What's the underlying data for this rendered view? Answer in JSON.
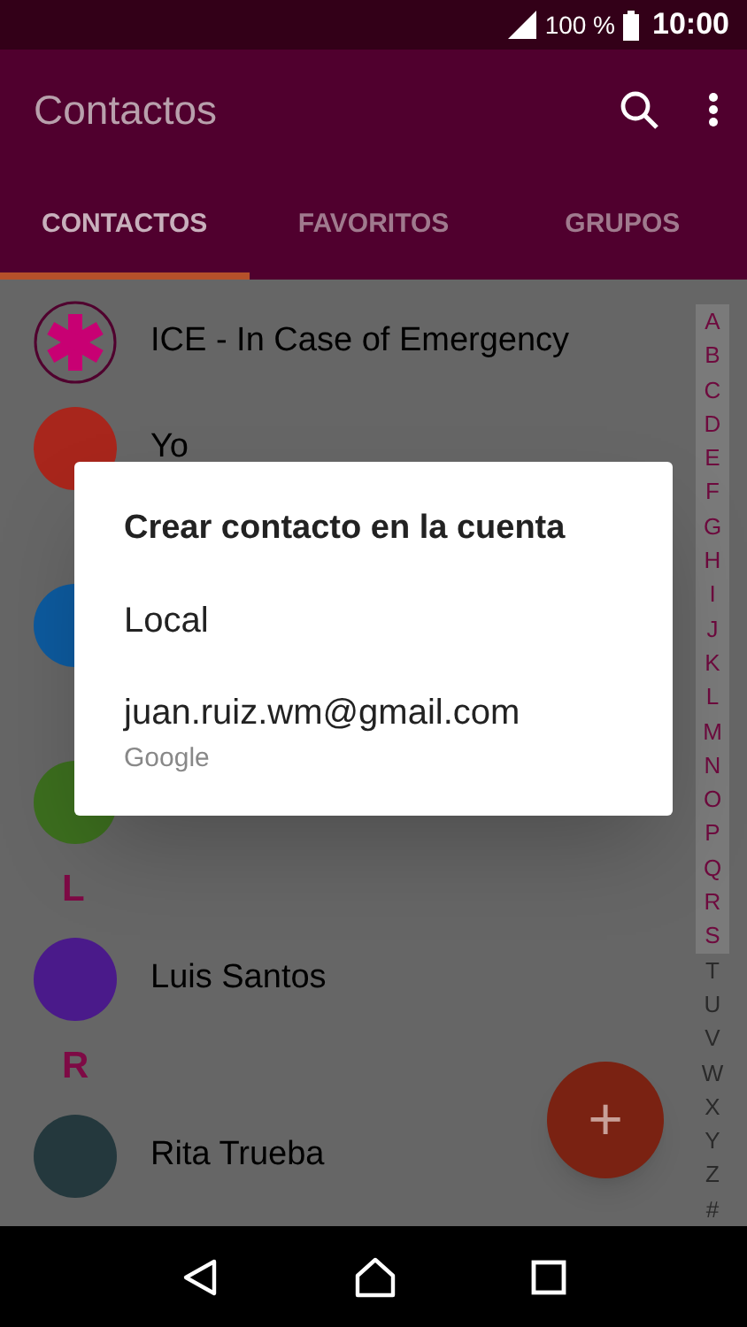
{
  "status_bar": {
    "battery": "100 %",
    "time": "10:00"
  },
  "app_bar": {
    "title": "Contactos"
  },
  "tabs": [
    {
      "label": "CONTACTOS",
      "selected": true
    },
    {
      "label": "FAVORITOS",
      "selected": false
    },
    {
      "label": "GRUPOS",
      "selected": false
    }
  ],
  "list": [
    {
      "kind": "ice",
      "name": "ICE - In Case of Emergency"
    },
    {
      "kind": "contact",
      "name": "Yo",
      "color": "#a8261c"
    },
    {
      "kind": "gap"
    },
    {
      "kind": "contact",
      "color": "#0d5a9e"
    },
    {
      "kind": "gap"
    },
    {
      "kind": "contact",
      "color": "#3c6e1e"
    },
    {
      "kind": "header",
      "letter": "L"
    },
    {
      "kind": "contact",
      "name": "Luis Santos",
      "color": "#4a1a8a"
    },
    {
      "kind": "header",
      "letter": "R"
    },
    {
      "kind": "contact",
      "name": "Rita Trueba",
      "color": "#24383d"
    }
  ],
  "index": [
    {
      "letter": "A",
      "highlighted": true
    },
    {
      "letter": "B",
      "highlighted": true
    },
    {
      "letter": "C",
      "highlighted": true
    },
    {
      "letter": "D",
      "highlighted": true
    },
    {
      "letter": "E",
      "highlighted": true
    },
    {
      "letter": "F",
      "highlighted": true
    },
    {
      "letter": "G",
      "highlighted": true
    },
    {
      "letter": "H",
      "highlighted": true
    },
    {
      "letter": "I",
      "highlighted": true
    },
    {
      "letter": "J",
      "highlighted": true
    },
    {
      "letter": "K",
      "highlighted": true
    },
    {
      "letter": "L",
      "highlighted": true
    },
    {
      "letter": "M",
      "highlighted": true
    },
    {
      "letter": "N",
      "highlighted": true
    },
    {
      "letter": "O",
      "highlighted": true
    },
    {
      "letter": "P",
      "highlighted": true
    },
    {
      "letter": "Q",
      "highlighted": true
    },
    {
      "letter": "R",
      "highlighted": true
    },
    {
      "letter": "S",
      "highlighted": true
    },
    {
      "letter": "T",
      "highlighted": false
    },
    {
      "letter": "U",
      "highlighted": false
    },
    {
      "letter": "V",
      "highlighted": false
    },
    {
      "letter": "W",
      "highlighted": false
    },
    {
      "letter": "X",
      "highlighted": false
    },
    {
      "letter": "Y",
      "highlighted": false
    },
    {
      "letter": "Z",
      "highlighted": false
    },
    {
      "letter": "#",
      "highlighted": false
    }
  ],
  "fab": {
    "label": "+"
  },
  "dialog": {
    "title": "Crear contacto en la cuenta",
    "options": [
      {
        "label": "Local"
      },
      {
        "label": "juan.ruiz.wm@gmail.com",
        "subtitle": "Google"
      }
    ]
  }
}
